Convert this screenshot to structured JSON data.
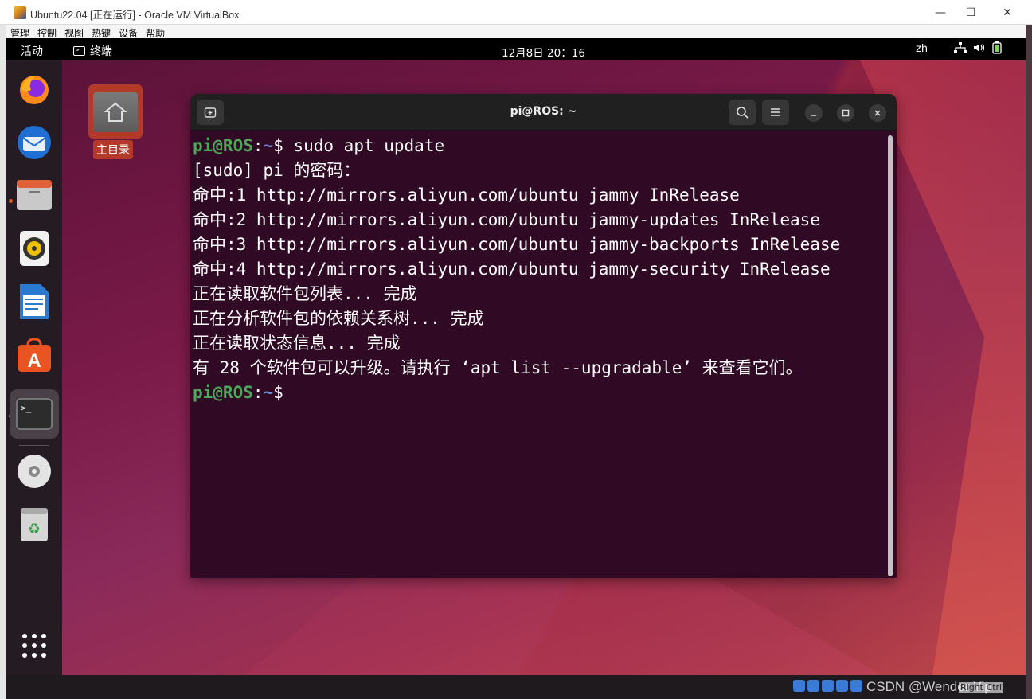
{
  "window": {
    "title": "Ubuntu22.04 [正在运行] - Oracle VM VirtualBox",
    "controls": {
      "minimize": "—",
      "maximize": "☐",
      "close": "✕"
    },
    "menu": [
      "管理",
      "控制",
      "视图",
      "热键",
      "设备",
      "帮助"
    ]
  },
  "topbar": {
    "activities": "活动",
    "app_indicator": "终端",
    "clock": "12月8日  20：16",
    "input_method": "zh"
  },
  "desktop": {
    "home_label": "主目录"
  },
  "dock": {
    "items": [
      {
        "name": "firefox",
        "running": false
      },
      {
        "name": "thunderbird",
        "running": false
      },
      {
        "name": "files",
        "running": true
      },
      {
        "name": "rhythmbox",
        "running": false
      },
      {
        "name": "libreoffice-writer",
        "running": false
      },
      {
        "name": "ubuntu-software",
        "running": false
      },
      {
        "name": "terminal",
        "running": true
      },
      {
        "name": "dvd",
        "running": false
      },
      {
        "name": "trash",
        "running": false
      }
    ]
  },
  "terminal": {
    "title": "pi@ROS: ~",
    "lines": [
      {
        "user": "pi@ROS",
        "sep": ":",
        "path": "~",
        "rest": "$ sudo apt update"
      },
      {
        "text": "[sudo] pi 的密码："
      },
      {
        "text": "命中:1 http://mirrors.aliyun.com/ubuntu jammy InRelease"
      },
      {
        "text": "命中:2 http://mirrors.aliyun.com/ubuntu jammy-updates InRelease"
      },
      {
        "text": "命中:3 http://mirrors.aliyun.com/ubuntu jammy-backports InRelease"
      },
      {
        "text": "命中:4 http://mirrors.aliyun.com/ubuntu jammy-security InRelease"
      },
      {
        "text": "正在读取软件包列表... 完成"
      },
      {
        "text": "正在分析软件包的依赖关系树... 完成"
      },
      {
        "text": "正在读取状态信息... 完成"
      },
      {
        "text": "有 28 个软件包可以升级。请执行 ‘apt list --upgradable’ 来查看它们。"
      },
      {
        "user": "pi@ROS",
        "sep": ":",
        "path": "~",
        "rest": "$ "
      }
    ]
  },
  "statusbar": {
    "watermark": "CSDN @Wender Yip",
    "host_key": "Right Ctrl"
  }
}
